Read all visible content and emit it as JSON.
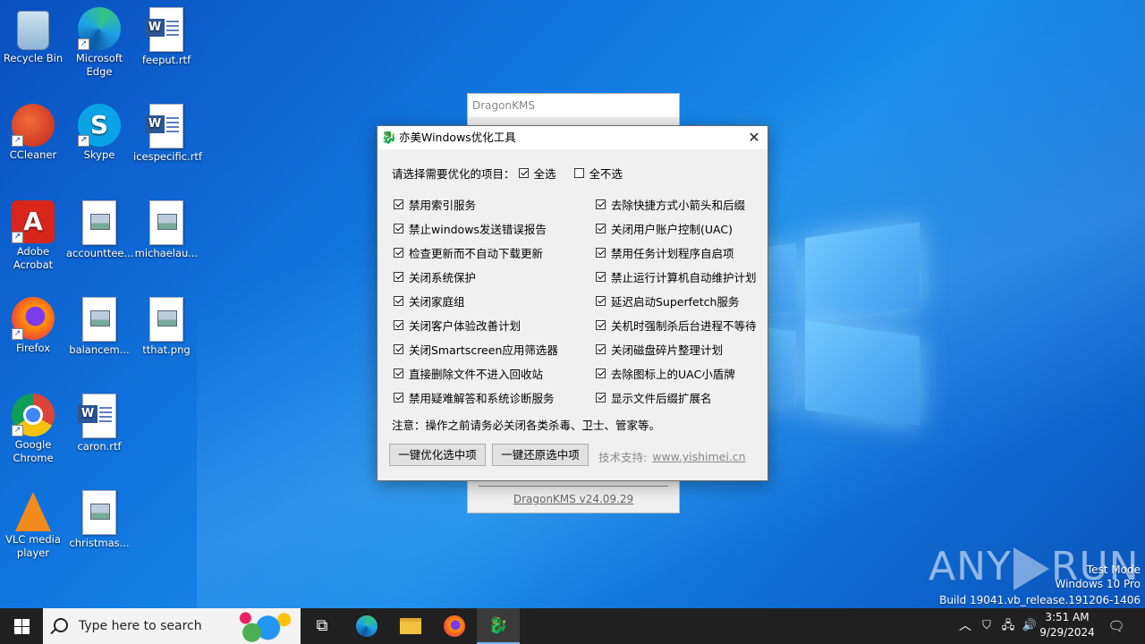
{
  "desktop": {
    "icons": [
      {
        "label": "Recycle Bin"
      },
      {
        "label": "Microsoft Edge"
      },
      {
        "label": "feeput.rtf"
      },
      {
        "label": "CCleaner"
      },
      {
        "label": "Skype"
      },
      {
        "label": "icespecific.rtf"
      },
      {
        "label": "Adobe Acrobat"
      },
      {
        "label": "accounttee..."
      },
      {
        "label": "michaelau..."
      },
      {
        "label": "Firefox"
      },
      {
        "label": "balancem..."
      },
      {
        "label": "tthat.png"
      },
      {
        "label": "Google Chrome"
      },
      {
        "label": "caron.rtf"
      },
      {
        "label": "VLC media player"
      },
      {
        "label": "christmas..."
      }
    ]
  },
  "kms_window": {
    "title": "DragonKMS",
    "version_link": "DragonKMS v24.09.29"
  },
  "dialog": {
    "title": "亦美Windows优化工具",
    "prompt": "请选择需要优化的项目：",
    "select_all": "全选",
    "select_none": "全不选",
    "options_left": [
      "禁用索引服务",
      "禁止windows发送错误报告",
      "检查更新而不自动下载更新",
      "关闭系统保护",
      "关闭家庭组",
      "关闭客户体验改善计划",
      "关闭Smartscreen应用筛选器",
      "直接删除文件不进入回收站",
      "禁用疑难解答和系统诊断服务"
    ],
    "options_right": [
      "去除快捷方式小箭头和后缀",
      "关闭用户账户控制(UAC)",
      "禁用任务计划程序自启项",
      "禁止运行计算机自动维护计划",
      "延迟启动Superfetch服务",
      "关机时强制杀后台进程不等待",
      "关闭磁盘碎片整理计划",
      "去除图标上的UAC小盾牌",
      "显示文件后缀扩展名"
    ],
    "warning": "注意：操作之前请务必关闭各类杀毒、卫士、管家等。",
    "btn_optimize": "一键优化选中项",
    "btn_restore": "一键还原选中项",
    "support_label": "技术支持:",
    "support_link": "www.yishimei.cn",
    "accent_red": "#c00000"
  },
  "watermark": {
    "brand_left": "ANY",
    "brand_right": "RUN",
    "test_mode": "Test Mode",
    "edition": "Windows 10 Pro",
    "build": "Build 19041.vb_release.191206-1406"
  },
  "taskbar": {
    "search_placeholder": "Type here to search",
    "time": "3:51 AM",
    "date": "9/29/2024"
  }
}
